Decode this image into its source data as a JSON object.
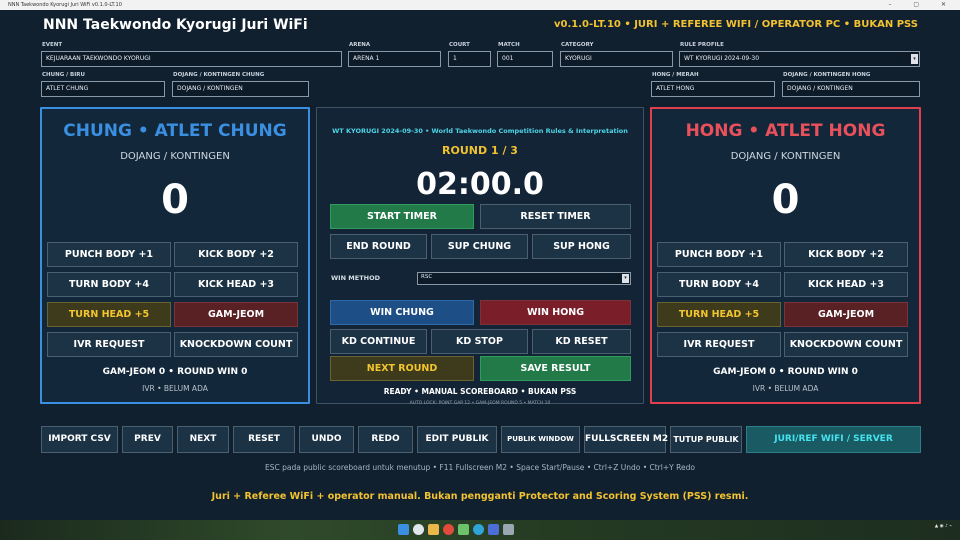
{
  "window": {
    "titlebar": "NNN Taekwondo Kyorugi Juri WiFi v0.1.0-LT.10",
    "controls": "–  ▢  ✕"
  },
  "header": {
    "title": "NNN Taekwondo Kyorugi Juri WiFi",
    "version": "v0.1.0-LT.10 • JURI + REFEREE WIFI / OPERATOR PC • BUKAN PSS"
  },
  "form": {
    "event_label": "EVENT",
    "event_value": "KEJUARAAN TAEKWONDO KYORUGI",
    "arena_label": "ARENA",
    "arena_value": "ARENA 1",
    "court_label": "COURT",
    "court_value": "1",
    "match_label": "MATCH",
    "match_value": "001",
    "category_label": "CATEGORY",
    "category_value": "KYORUGI",
    "rule_label": "RULE PROFILE",
    "rule_value": "WT KYORUGI 2024-09-30",
    "chung_label": "CHUNG / BIRU",
    "chung_value": "ATLET CHUNG",
    "chung_dojang_label": "DOJANG / KONTINGEN CHUNG",
    "chung_dojang_value": "DOJANG / KONTINGEN",
    "hong_label": "HONG / MERAH",
    "hong_value": "ATLET HONG",
    "hong_dojang_label": "DOJANG / KONTINGEN HONG",
    "hong_dojang_value": "DOJANG / KONTINGEN"
  },
  "chung": {
    "title": "CHUNG • ATLET CHUNG",
    "dojang": "DOJANG / KONTINGEN",
    "score": "0",
    "buttons": [
      "PUNCH BODY  +1",
      "KICK BODY  +2",
      "TURN BODY  +4",
      "KICK HEAD  +3",
      "TURN HEAD  +5",
      "GAM-JEOM",
      "IVR REQUEST",
      "KNOCKDOWN COUNT"
    ],
    "footer": "GAM-JEOM 0  •  ROUND WIN 0",
    "ivr": "IVR • BELUM ADA"
  },
  "hong": {
    "title": "HONG • ATLET HONG",
    "dojang": "DOJANG / KONTINGEN",
    "score": "0",
    "buttons": [
      "PUNCH BODY  +1",
      "KICK BODY  +2",
      "TURN BODY  +4",
      "KICK HEAD  +3",
      "TURN HEAD  +5",
      "GAM-JEOM",
      "IVR REQUEST",
      "KNOCKDOWN COUNT"
    ],
    "footer": "GAM-JEOM 0  •  ROUND WIN 0",
    "ivr": "IVR • BELUM ADA"
  },
  "center": {
    "rules_header": "WT KYORUGI 2024-09-30 • World Taekwondo Competition Rules & Interpretation",
    "round": "ROUND 1 / 3",
    "timer": "02:00.0",
    "start_timer": "START TIMER",
    "reset_timer": "RESET TIMER",
    "end_round": "END ROUND",
    "sup_chung": "SUP CHUNG",
    "sup_hong": "SUP HONG",
    "win_method_label": "WIN METHOD",
    "win_method_value": "RSC",
    "win_chung": "WIN CHUNG",
    "win_hong": "WIN HONG",
    "kd_continue": "KD CONTINUE",
    "kd_stop": "KD STOP",
    "kd_reset": "KD RESET",
    "next_round": "NEXT ROUND",
    "save_result": "SAVE RESULT",
    "status": "READY • MANUAL SCOREBOARD • BUKAN PSS",
    "autolock": "AUTO LOCK: POINT GAP 12 • GAM-JEOM ROUND 5 • MATCH 10"
  },
  "bottom": {
    "import_csv": "IMPORT CSV",
    "prev": "PREV",
    "next": "NEXT",
    "reset": "RESET",
    "undo": "UNDO",
    "redo": "REDO",
    "edit_publik": "EDIT PUBLIK",
    "publik_window": "PUBLIK WINDOW",
    "fullscreen_m2": "FULLSCREEN M2",
    "tutup_publik": "TUTUP PUBLIK",
    "wifi_server": "JURI/REF WIFI / SERVER"
  },
  "hint": "ESC pada public scoreboard untuk menutup • F11 Fullscreen M2 • Space Start/Pause • Ctrl+Z Undo • Ctrl+Y Redo",
  "note": "Juri + Referee WiFi + operator manual. Bukan pengganti Protector and Scoring System (PSS) resmi.",
  "colors": {
    "chung": "#3a8fe0",
    "hong": "#e0404e",
    "accent": "#f2c230",
    "teal": "#4fd4e6"
  },
  "taskbar_icons": [
    "windows-icon",
    "search-icon",
    "file-explorer-icon",
    "chrome-icon",
    "app-icon",
    "edge-icon",
    "store-icon",
    "settings-icon"
  ]
}
